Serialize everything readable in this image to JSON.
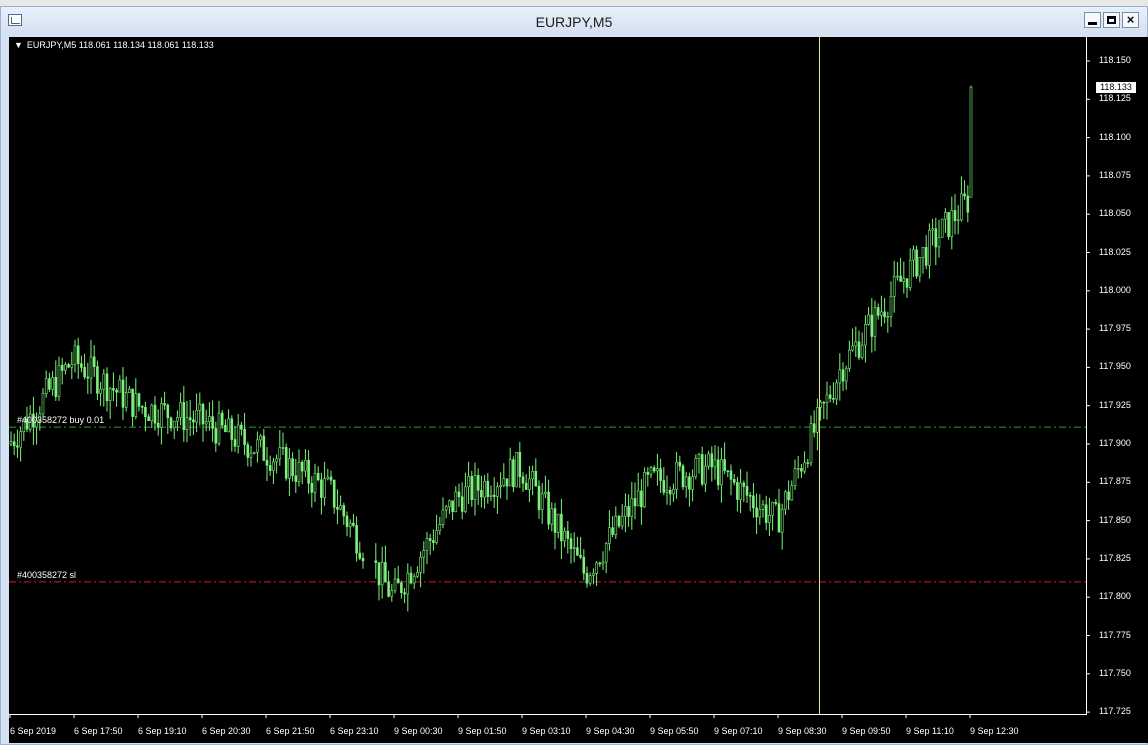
{
  "window": {
    "title": "EURJPY,M5",
    "controls": [
      {
        "name": "minimize",
        "icon": "minimize-icon"
      },
      {
        "name": "maximize",
        "icon": "restore-icon"
      },
      {
        "name": "close",
        "icon": "close-icon",
        "glyph": "×"
      }
    ]
  },
  "chart": {
    "header": "EURJPY,M5  118.061 118.134 118.061 118.133",
    "symbol": "EURJPY",
    "timeframe": "M5",
    "ohlc": {
      "open": "118.061",
      "high": "118.134",
      "low": "118.061",
      "close": "118.133"
    },
    "current_price": "118.133",
    "price_axis": [
      "118.150",
      "118.125",
      "118.100",
      "118.075",
      "118.050",
      "118.025",
      "118.000",
      "117.975",
      "117.950",
      "117.925",
      "117.900",
      "117.875",
      "117.850",
      "117.825",
      "117.800",
      "117.775",
      "117.750",
      "117.725"
    ],
    "time_axis": [
      "6 Sep 2019",
      "6 Sep 17:50",
      "6 Sep 19:10",
      "6 Sep 20:30",
      "6 Sep 21:50",
      "6 Sep 23:10",
      "9 Sep 00:30",
      "9 Sep 01:50",
      "9 Sep 03:10",
      "9 Sep 04:30",
      "9 Sep 05:50",
      "9 Sep 07:10",
      "9 Sep 08:30",
      "9 Sep 09:50",
      "9 Sep 11:10",
      "9 Sep 12:30"
    ],
    "orders": {
      "buy": {
        "label": "#400358272 buy 0.01",
        "price": 117.911,
        "color": "#2e9f2e"
      },
      "sl": {
        "label": "#400358272 sl",
        "price": 117.81,
        "color": "#cc1f1f"
      }
    },
    "colors": {
      "background": "#000000",
      "candles": "#7cf27c",
      "cursor": "#e8e871",
      "axis_text": "#ffffff"
    }
  },
  "chart_data": {
    "type": "candlestick",
    "title": "EURJPY,M5",
    "ylim": [
      117.72,
      118.155
    ],
    "x": [
      "6 Sep 2019",
      "6 Sep 17:50",
      "6 Sep 19:10",
      "6 Sep 20:30",
      "6 Sep 21:50",
      "6 Sep 23:10",
      "9 Sep 00:30",
      "9 Sep 01:50",
      "9 Sep 03:10",
      "9 Sep 04:30",
      "9 Sep 05:50",
      "9 Sep 07:10",
      "9 Sep 08:30",
      "9 Sep 09:50",
      "9 Sep 11:10",
      "9 Sep 12:30"
    ],
    "approx_close_at_ticks": [
      117.9,
      117.955,
      117.925,
      117.915,
      117.895,
      117.87,
      117.8,
      117.865,
      117.885,
      117.815,
      117.875,
      117.885,
      117.85,
      117.95,
      118.01,
      118.06
    ],
    "last": {
      "open": 118.061,
      "high": 118.134,
      "low": 118.061,
      "close": 118.133
    },
    "levels": [
      {
        "name": "#400358272 buy 0.01",
        "value": 117.911
      },
      {
        "name": "#400358272 sl",
        "value": 117.81
      }
    ],
    "grid": false
  }
}
